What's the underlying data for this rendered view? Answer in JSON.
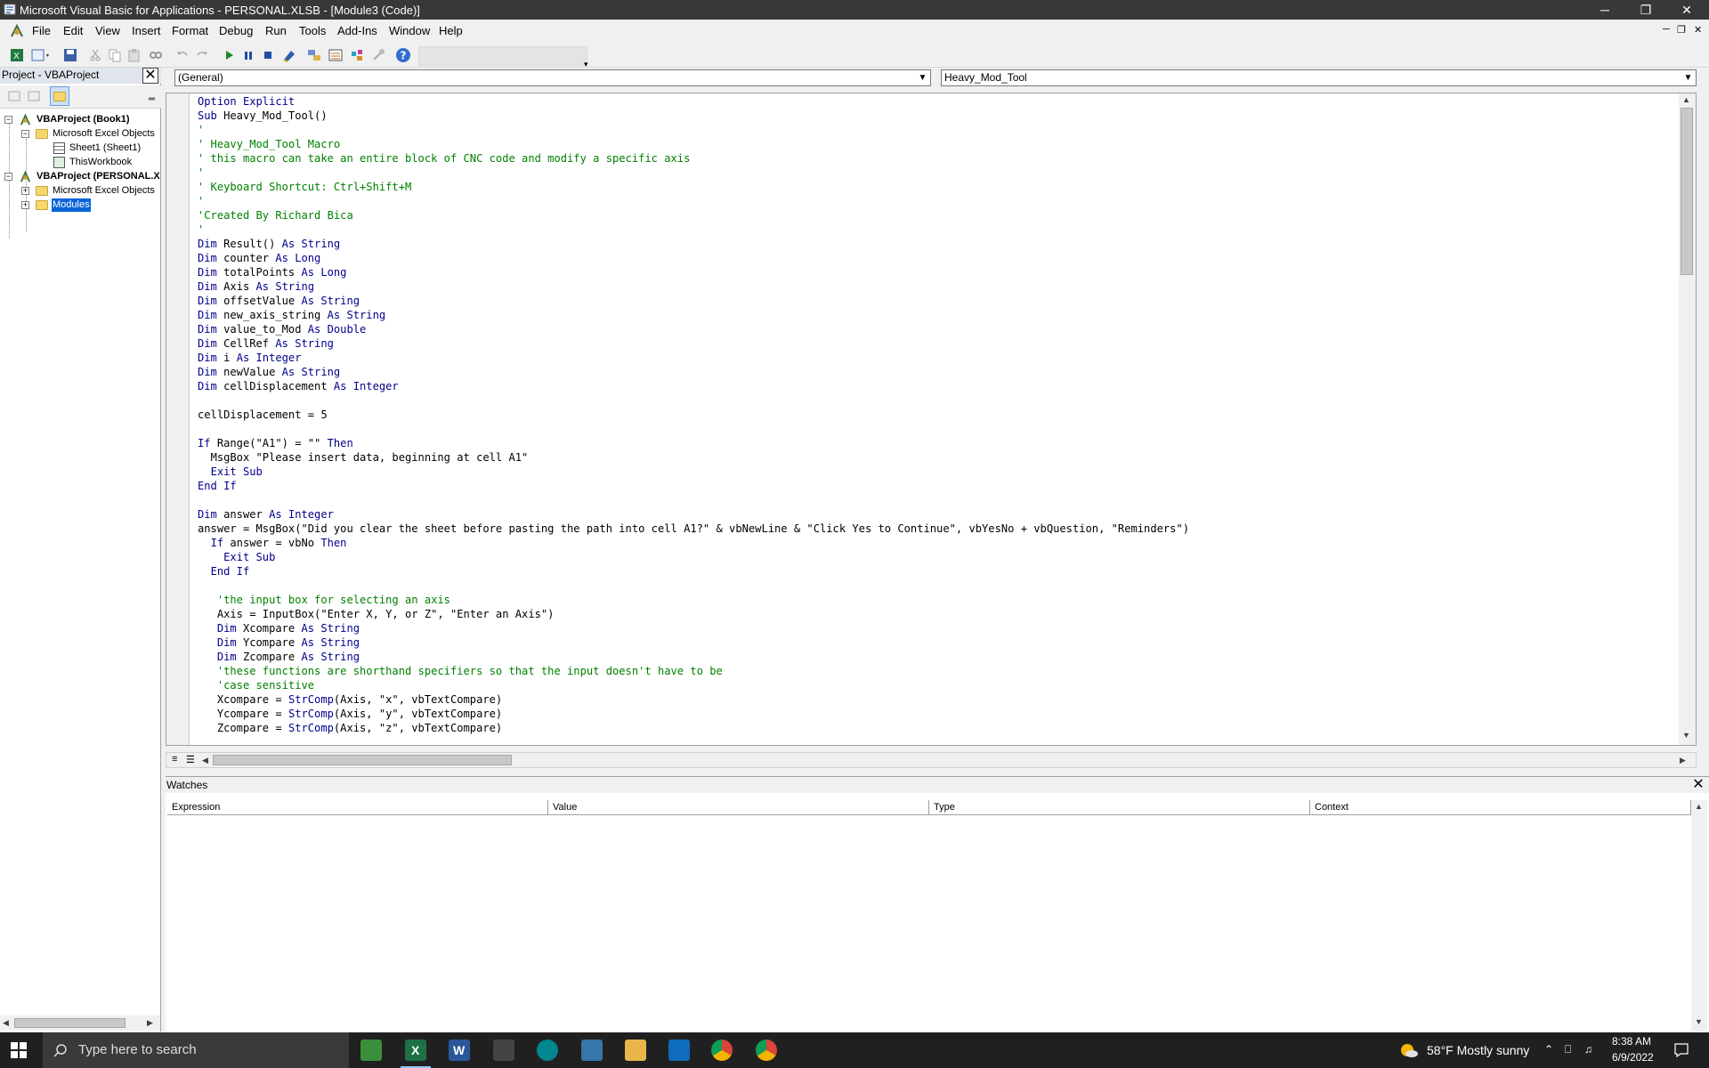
{
  "window": {
    "title": "Microsoft Visual Basic for Applications - PERSONAL.XLSB - [Module3 (Code)]"
  },
  "menu": {
    "items": [
      {
        "label": "File"
      },
      {
        "label": "Edit"
      },
      {
        "label": "View"
      },
      {
        "label": "Insert"
      },
      {
        "label": "Format"
      },
      {
        "label": "Debug"
      },
      {
        "label": "Run"
      },
      {
        "label": "Tools"
      },
      {
        "label": "Add-Ins"
      },
      {
        "label": "Window"
      },
      {
        "label": "Help"
      }
    ]
  },
  "toolbar": {
    "icons": [
      "view-excel-icon",
      "insert-module-icon",
      "save-icon",
      "cut-icon",
      "copy-icon",
      "paste-icon",
      "find-icon",
      "undo-icon",
      "redo-icon",
      "run-icon",
      "break-icon",
      "reset-icon",
      "design-mode-icon",
      "project-explorer-icon",
      "properties-window-icon",
      "object-browser-icon",
      "toolbox-icon",
      "help-icon"
    ]
  },
  "project_explorer": {
    "title": "Project - VBAProject",
    "tree": {
      "book1": "VBAProject (Book1)",
      "book1_objects": "Microsoft Excel Objects",
      "sheet1": "Sheet1 (Sheet1)",
      "thisworkbook": "ThisWorkbook",
      "personal": "VBAProject (PERSONAL.X",
      "personal_objects": "Microsoft Excel Objects",
      "modules": "Modules"
    }
  },
  "code_window": {
    "object_combo": "(General)",
    "procedure_combo": "Heavy_Mod_Tool",
    "lines": [
      {
        "indent": "",
        "parts": [
          [
            "kw",
            "Option Explicit"
          ]
        ]
      },
      {
        "indent": "",
        "parts": [
          [
            "kw",
            "Sub "
          ],
          [
            "",
            "Heavy_Mod_Tool()"
          ]
        ]
      },
      {
        "indent": "",
        "parts": [
          [
            "cm",
            "'"
          ]
        ]
      },
      {
        "indent": "",
        "parts": [
          [
            "cm",
            "' Heavy_Mod_Tool Macro"
          ]
        ]
      },
      {
        "indent": "",
        "parts": [
          [
            "cm",
            "' this macro can take an entire block of CNC code and modify a specific axis"
          ]
        ]
      },
      {
        "indent": "",
        "parts": [
          [
            "cm",
            "'"
          ]
        ]
      },
      {
        "indent": "",
        "parts": [
          [
            "cm",
            "' Keyboard Shortcut: Ctrl+Shift+M"
          ]
        ]
      },
      {
        "indent": "",
        "parts": [
          [
            "cm",
            "'"
          ]
        ]
      },
      {
        "indent": "",
        "parts": [
          [
            "cm",
            "'Created By Richard Bica"
          ]
        ]
      },
      {
        "indent": "",
        "parts": [
          [
            "cm",
            "'"
          ]
        ]
      },
      {
        "indent": "",
        "parts": [
          [
            "kw",
            "Dim "
          ],
          [
            "",
            "Result() "
          ],
          [
            "kw",
            "As String"
          ]
        ]
      },
      {
        "indent": "",
        "parts": [
          [
            "kw",
            "Dim "
          ],
          [
            "",
            "counter "
          ],
          [
            "kw",
            "As Long"
          ]
        ]
      },
      {
        "indent": "",
        "parts": [
          [
            "kw",
            "Dim "
          ],
          [
            "",
            "totalPoints "
          ],
          [
            "kw",
            "As Long"
          ]
        ]
      },
      {
        "indent": "",
        "parts": [
          [
            "kw",
            "Dim "
          ],
          [
            "",
            "Axis "
          ],
          [
            "kw",
            "As String"
          ]
        ]
      },
      {
        "indent": "",
        "parts": [
          [
            "kw",
            "Dim "
          ],
          [
            "",
            "offsetValue "
          ],
          [
            "kw",
            "As String"
          ]
        ]
      },
      {
        "indent": "",
        "parts": [
          [
            "kw",
            "Dim "
          ],
          [
            "",
            "new_axis_string "
          ],
          [
            "kw",
            "As String"
          ]
        ]
      },
      {
        "indent": "",
        "parts": [
          [
            "kw",
            "Dim "
          ],
          [
            "",
            "value_to_Mod "
          ],
          [
            "kw",
            "As Double"
          ]
        ]
      },
      {
        "indent": "",
        "parts": [
          [
            "kw",
            "Dim "
          ],
          [
            "",
            "CellRef "
          ],
          [
            "kw",
            "As String"
          ]
        ]
      },
      {
        "indent": "",
        "parts": [
          [
            "kw",
            "Dim "
          ],
          [
            "",
            "i "
          ],
          [
            "kw",
            "As Integer"
          ]
        ]
      },
      {
        "indent": "",
        "parts": [
          [
            "kw",
            "Dim "
          ],
          [
            "",
            "newValue "
          ],
          [
            "kw",
            "As String"
          ]
        ]
      },
      {
        "indent": "",
        "parts": [
          [
            "kw",
            "Dim "
          ],
          [
            "",
            "cellDisplacement "
          ],
          [
            "kw",
            "As Integer"
          ]
        ]
      },
      {
        "indent": "",
        "parts": [
          [
            "",
            ""
          ]
        ]
      },
      {
        "indent": "",
        "parts": [
          [
            "",
            "cellDisplacement = 5"
          ]
        ]
      },
      {
        "indent": "",
        "parts": [
          [
            "",
            ""
          ]
        ]
      },
      {
        "indent": "",
        "parts": [
          [
            "kw",
            "If "
          ],
          [
            "",
            "Range(\"A1\") = \"\" "
          ],
          [
            "kw",
            "Then"
          ]
        ]
      },
      {
        "indent": "  ",
        "parts": [
          [
            "",
            "MsgBox \"Please insert data, beginning at cell A1\""
          ]
        ]
      },
      {
        "indent": "  ",
        "parts": [
          [
            "kw",
            "Exit Sub"
          ]
        ]
      },
      {
        "indent": "",
        "parts": [
          [
            "kw",
            "End If"
          ]
        ]
      },
      {
        "indent": "",
        "parts": [
          [
            "",
            ""
          ]
        ]
      },
      {
        "indent": "",
        "parts": [
          [
            "kw",
            "Dim "
          ],
          [
            "",
            "answer "
          ],
          [
            "kw",
            "As Integer"
          ]
        ]
      },
      {
        "indent": "",
        "parts": [
          [
            "",
            "answer = MsgBox(\"Did you clear the sheet before pasting the path into cell A1?\" & vbNewLine & \"Click Yes to Continue\", vbYesNo + vbQuestion, \"Reminders\")"
          ]
        ]
      },
      {
        "indent": "  ",
        "parts": [
          [
            "kw",
            "If "
          ],
          [
            "",
            "answer = vbNo "
          ],
          [
            "kw",
            "Then"
          ]
        ]
      },
      {
        "indent": "    ",
        "parts": [
          [
            "kw",
            "Exit Sub"
          ]
        ]
      },
      {
        "indent": "  ",
        "parts": [
          [
            "kw",
            "End If"
          ]
        ]
      },
      {
        "indent": "",
        "parts": [
          [
            "",
            ""
          ]
        ]
      },
      {
        "indent": "   ",
        "parts": [
          [
            "cm",
            "'the input box for selecting an axis"
          ]
        ]
      },
      {
        "indent": "   ",
        "parts": [
          [
            "",
            "Axis = InputBox(\"Enter X, Y, or Z\", \"Enter an Axis\")"
          ]
        ]
      },
      {
        "indent": "   ",
        "parts": [
          [
            "kw",
            "Dim "
          ],
          [
            "",
            "Xcompare "
          ],
          [
            "kw",
            "As String"
          ]
        ]
      },
      {
        "indent": "   ",
        "parts": [
          [
            "kw",
            "Dim "
          ],
          [
            "",
            "Ycompare "
          ],
          [
            "kw",
            "As String"
          ]
        ]
      },
      {
        "indent": "   ",
        "parts": [
          [
            "kw",
            "Dim "
          ],
          [
            "",
            "Zcompare "
          ],
          [
            "kw",
            "As String"
          ]
        ]
      },
      {
        "indent": "   ",
        "parts": [
          [
            "cm",
            "'these functions are shorthand specifiers so that the input doesn't have to be"
          ]
        ]
      },
      {
        "indent": "   ",
        "parts": [
          [
            "cm",
            "'case sensitive"
          ]
        ]
      },
      {
        "indent": "   ",
        "parts": [
          [
            "",
            "Xcompare = "
          ],
          [
            "kw",
            "StrComp"
          ],
          [
            "",
            "(Axis, \"x\", vbTextCompare)"
          ]
        ]
      },
      {
        "indent": "   ",
        "parts": [
          [
            "",
            "Ycompare = "
          ],
          [
            "kw",
            "StrComp"
          ],
          [
            "",
            "(Axis, \"y\", vbTextCompare)"
          ]
        ]
      },
      {
        "indent": "   ",
        "parts": [
          [
            "",
            "Zcompare = "
          ],
          [
            "kw",
            "StrComp"
          ],
          [
            "",
            "(Axis, \"z\", vbTextCompare)"
          ]
        ]
      }
    ]
  },
  "watches": {
    "title": "Watches",
    "columns": [
      "Expression",
      "Value",
      "Type",
      "Context"
    ]
  },
  "taskbar": {
    "search_placeholder": "Type here to search",
    "weather": "58°F  Mostly sunny",
    "time": "8:38 AM",
    "date": "6/9/2022",
    "apps": [
      "notepad-icon",
      "excel-icon",
      "word-icon",
      "calculator-icon",
      "arduino-icon",
      "python-icon",
      "file-explorer-icon",
      "outlook-icon",
      "chrome-icon",
      "chrome-profile-icon"
    ]
  },
  "colors": {
    "keyword": "#00008b",
    "comment": "#008000",
    "titlebar": "#383838",
    "taskbar": "#202020"
  }
}
